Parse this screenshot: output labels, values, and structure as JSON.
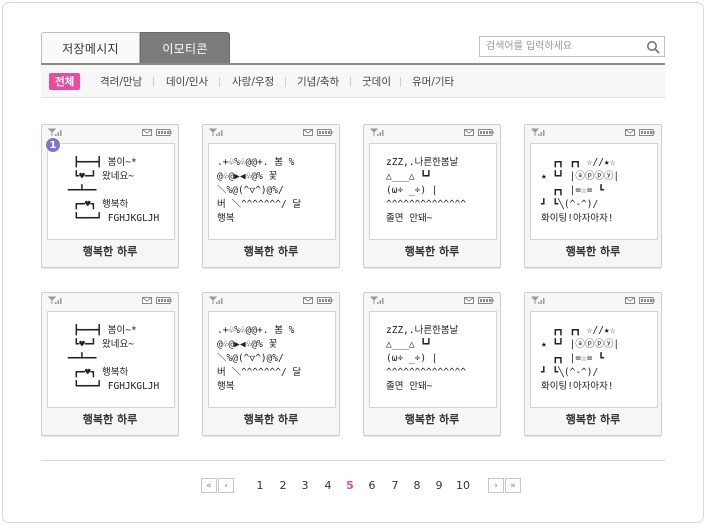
{
  "tabs": [
    {
      "label": "저장메시지",
      "active": false
    },
    {
      "label": "이모티콘",
      "active": true
    }
  ],
  "search": {
    "placeholder": "검색어를 입력하세요"
  },
  "categories": [
    "전체",
    "격려/만남",
    "데이/인사",
    "사랑/우정",
    "기념/축하",
    "굿데이",
    "유머/기타"
  ],
  "colors": {
    "accent": "#e64ca0",
    "active_tab": "#7c7c7c",
    "badge": "#7b78c9"
  },
  "cards": [
    {
      "badge": "1",
      "text": "  ┣━━━┫ 봄이~*\n  ┗♥━┛ 왔네요~\n ━━┻━━\n  ┏━♥┓ 행복하\n  ┗━━━┛ FGHJKGLJH",
      "title": "행복한 하루"
    },
    {
      "text": ".+♧%♧@@+. 봄 %\n@♧@▶◀♧@% 꽃\n＼%@(^▽^)@%/\n버 ＼^^^^^^^/ 달\n행복",
      "title": "행복한 하루"
    },
    {
      "text": "zZZ,.나른한봄날\n△___△ ┗┛\n(ω÷ _÷) |\n^^^^^^^^^^^^^^\n졸면 안돼~",
      "title": "행복한 하루"
    },
    {
      "text": "  ┏┓ ┏┓ ☆//★☆\n★ ┗┛ |ⓐⓟⓟⓨ|\n  ┏┓ |=☆= ┗\n┛ ┗╲(^-^)/\n화이팅!아자아자!",
      "title": "행복한 하루"
    },
    {
      "text": "  ┣━━━┫ 봄이~*\n  ┗♥━┛ 왔네요~\n ━━┻━━\n  ┏━♥┓ 행복하\n  ┗━━━┛ FGHJKGLJH",
      "title": "행복한 하루"
    },
    {
      "text": ".+♧%♧@@+. 봄 %\n@♧@▶◀♧@% 꽃\n＼%@(^▽^)@%/\n버 ＼^^^^^^^/ 달\n행복",
      "title": "행복한 하루"
    },
    {
      "text": "zZZ,.나른한봄날\n△___△ ┗┛\n(ω÷ _÷) |\n^^^^^^^^^^^^^^\n졸면 안돼~",
      "title": "행복한 하루"
    },
    {
      "text": "  ┏┓ ┏┓ ☆//★☆\n★ ┗┛ |ⓐⓟⓟⓨ|\n  ┏┓ |=☆= ┗\n┛ ┗╲(^-^)/\n화이팅!아자아자!",
      "title": "행복한 하루"
    }
  ],
  "pagination": {
    "first": "«",
    "prev": "‹",
    "next": "›",
    "last": "»",
    "pages": [
      "1",
      "2",
      "3",
      "4",
      "5",
      "6",
      "7",
      "8",
      "9",
      "10"
    ],
    "current": "5"
  }
}
